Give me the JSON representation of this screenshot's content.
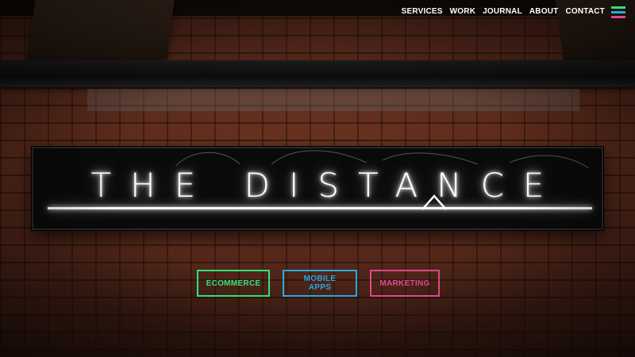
{
  "nav": {
    "items": [
      "SERVICES",
      "WORK",
      "JOURNAL",
      "ABOUT",
      "CONTACT"
    ],
    "menu_icon": "hamburger-icon",
    "menu_colors": [
      "#33e07a",
      "#2aa8e0",
      "#e0468c"
    ]
  },
  "hero": {
    "sign_text": "THE DISTANCE"
  },
  "cta": {
    "ecommerce_label": "ECOMMERCE",
    "ecommerce_color": "#33e07a",
    "mobile_label": "MOBILE APPS",
    "mobile_color": "#2aa8e0",
    "marketing_label": "MARKETING",
    "marketing_color": "#e0468c"
  }
}
